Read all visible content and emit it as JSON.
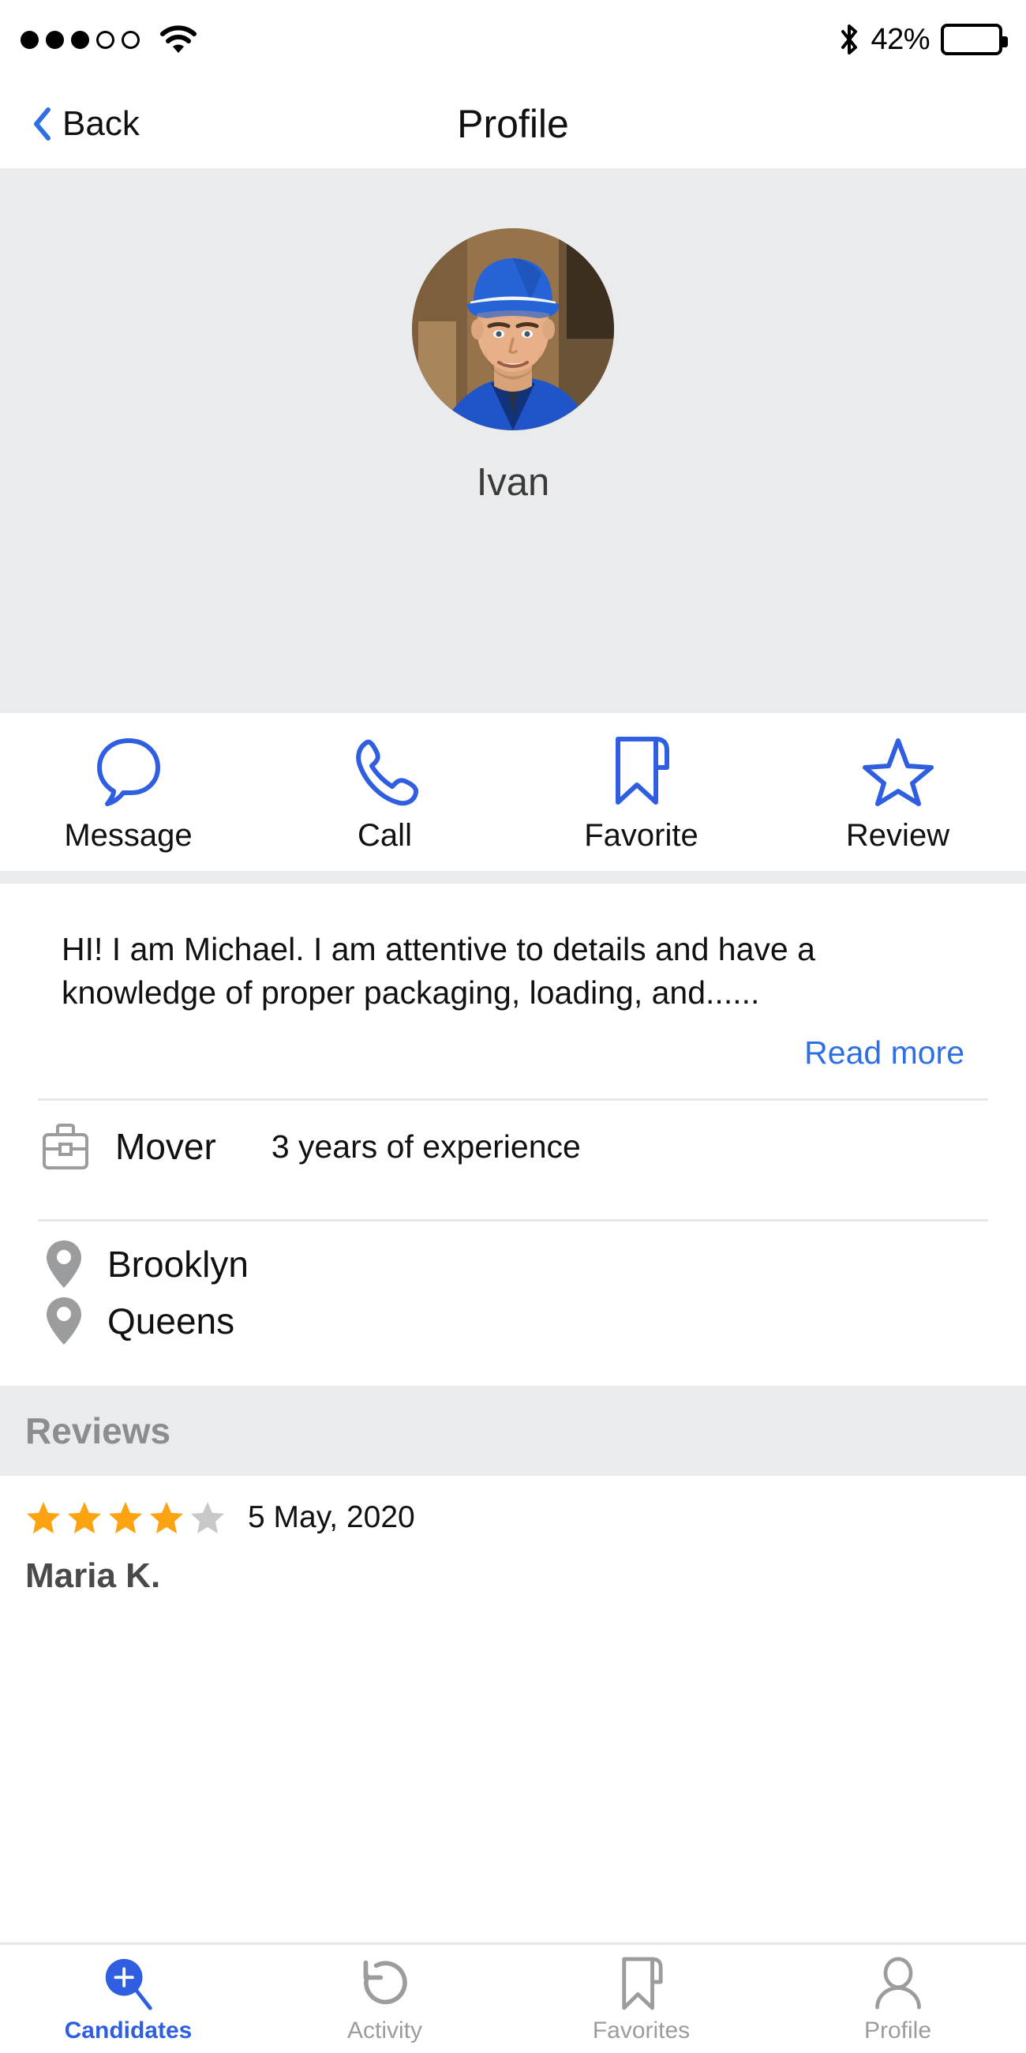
{
  "status_bar": {
    "signal_total": 5,
    "signal_filled": 3,
    "wifi_icon": "wifi-icon",
    "bluetooth_icon": "bluetooth-icon",
    "battery_percent": "42%",
    "battery_level": 45
  },
  "nav": {
    "back_label": "Back",
    "back_icon": "chevron-left-icon",
    "title": "Profile"
  },
  "hero": {
    "avatar_alt": "avatar-photo",
    "name": "Ivan"
  },
  "actions": [
    {
      "label": "Message",
      "icon": "speech-bubble-icon"
    },
    {
      "label": "Call",
      "icon": "phone-icon"
    },
    {
      "label": "Favorite",
      "icon": "bookmark-icon"
    },
    {
      "label": "Review",
      "icon": "star-icon"
    }
  ],
  "bio": {
    "text": "HI! I am Michael. I am attentive to details and have a knowledge of proper packaging, loading, and......",
    "read_more": "Read more"
  },
  "job": {
    "icon": "briefcase-icon",
    "title": "Mover",
    "experience": "3 years of experience"
  },
  "locations": [
    {
      "icon": "map-pin-icon",
      "label": "Brooklyn"
    },
    {
      "icon": "map-pin-icon",
      "label": "Queens"
    }
  ],
  "reviews": {
    "header": "Reviews",
    "items": [
      {
        "rating": 4,
        "max_rating": 5,
        "date": "5 May, 2020",
        "author": "Maria K."
      }
    ]
  },
  "tabs": [
    {
      "label": "Candidates",
      "icon": "search-plus-icon",
      "active": true
    },
    {
      "label": "Activity",
      "icon": "undo-arrow-icon",
      "active": false
    },
    {
      "label": "Favorites",
      "icon": "bookmark-icon",
      "active": false
    },
    {
      "label": "Profile",
      "icon": "person-icon",
      "active": false
    }
  ],
  "colors": {
    "accent_blue": "#2f5fe0",
    "link_blue": "#2f6fe4",
    "star_active": "#fca311",
    "star_inactive": "#c6c8ca",
    "gray_band": "#eaebec",
    "icon_gray": "#9a9c9e"
  }
}
